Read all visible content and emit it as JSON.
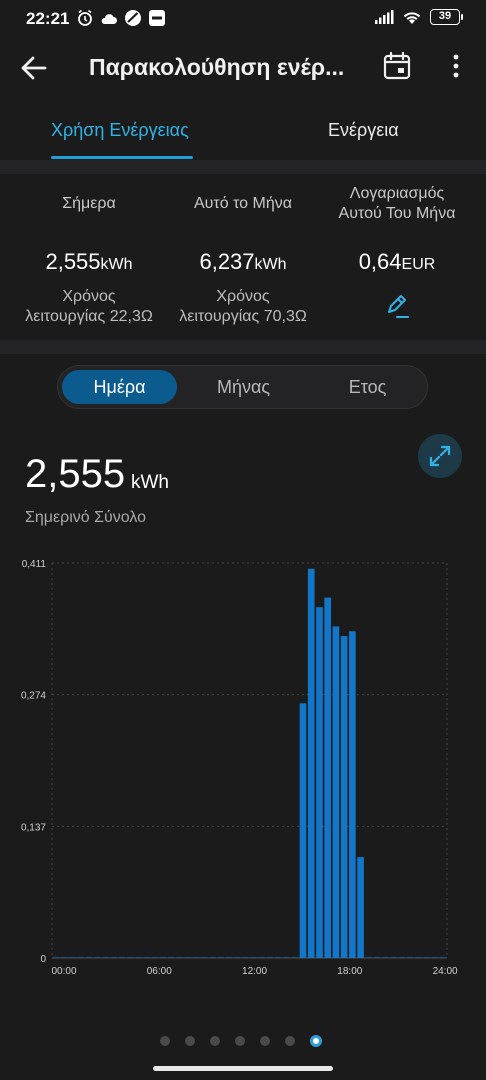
{
  "status_bar": {
    "time": "22:21",
    "battery": "39"
  },
  "app_bar": {
    "title": "Παρακολούθηση ενέρ...",
    "icons": [
      "back-arrow-icon",
      "calendar-icon",
      "more-vert-icon"
    ]
  },
  "tabs": [
    {
      "label": "Χρήση Ενέργειας",
      "active": true
    },
    {
      "label": "Ενέργεια",
      "active": false
    }
  ],
  "stats": {
    "today": {
      "heading": "Σήμερα",
      "value": "2,555",
      "unit": "kWh",
      "sub1": "Χρόνος",
      "sub2": "λειτουργίας 22,3Ω"
    },
    "month": {
      "heading": "Αυτό το Μήνα",
      "value": "6,237",
      "unit": "kWh",
      "sub1": "Χρόνος",
      "sub2": "λειτουργίας 70,3Ω"
    },
    "bill": {
      "heading1": "Λογαριασμός",
      "heading2": "Αυτού Του Μήνα",
      "value": "0,64",
      "unit": "EUR"
    }
  },
  "segment": {
    "day": "Ημέρα",
    "month": "Μήνας",
    "year": "Ετος",
    "selected": "day"
  },
  "summary": {
    "value": "2,555",
    "unit": "kWh",
    "label": "Σημερινό Σύνολο"
  },
  "colors": {
    "accent": "#2fb3e6",
    "bar": "#1377c9",
    "selected_segment": "#0c5b8f"
  },
  "chart_data": {
    "type": "bar",
    "x": [
      "00:00",
      "00:30",
      "01:00",
      "01:30",
      "02:00",
      "02:30",
      "03:00",
      "03:30",
      "04:00",
      "04:30",
      "05:00",
      "05:30",
      "06:00",
      "06:30",
      "07:00",
      "07:30",
      "08:00",
      "08:30",
      "09:00",
      "09:30",
      "10:00",
      "10:30",
      "11:00",
      "11:30",
      "12:00",
      "12:30",
      "13:00",
      "13:30",
      "14:00",
      "14:30",
      "15:00",
      "15:30",
      "16:00",
      "16:30",
      "17:00",
      "17:30",
      "18:00",
      "18:30",
      "19:00",
      "19:30",
      "20:00",
      "20:30",
      "21:00",
      "21:30",
      "22:00",
      "22:30",
      "23:00",
      "23:30"
    ],
    "values": [
      0,
      0,
      0,
      0,
      0,
      0,
      0,
      0,
      0,
      0,
      0,
      0,
      0,
      0,
      0,
      0,
      0,
      0,
      0,
      0,
      0,
      0,
      0,
      0,
      0,
      0,
      0,
      0,
      0,
      0,
      0.265,
      0.405,
      0.365,
      0.375,
      0.345,
      0.335,
      0.34,
      0.105,
      0,
      0,
      0,
      0,
      0,
      0,
      0,
      0,
      0,
      0
    ],
    "xticks": [
      "00:00",
      "06:00",
      "12:00",
      "18:00",
      "24:00"
    ],
    "yticks": [
      "0",
      "0,137",
      "0,274",
      "0,411"
    ],
    "ylim": [
      0,
      0.411
    ],
    "grid": true
  },
  "pager": {
    "count": 7,
    "active": 6
  }
}
